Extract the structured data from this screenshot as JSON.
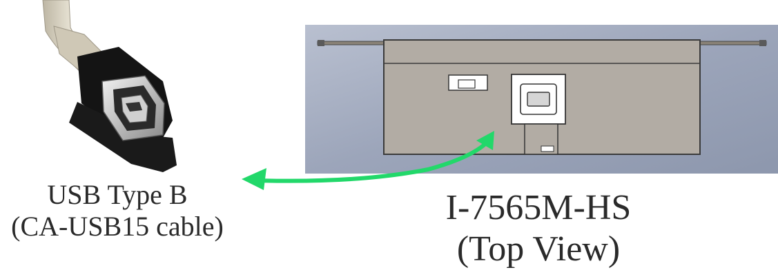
{
  "left_caption": {
    "line1": "USB Type B",
    "line2": "(CA-USB15 cable)"
  },
  "right_caption": {
    "line1": "I-7565M-HS",
    "line2": "(Top View)"
  },
  "colors": {
    "arrow": "#22d86a",
    "panel_background": "#9aa3b8",
    "device_body": "#b2aca4",
    "cable": "#d8d2c2",
    "connector_housing": "#111111"
  }
}
